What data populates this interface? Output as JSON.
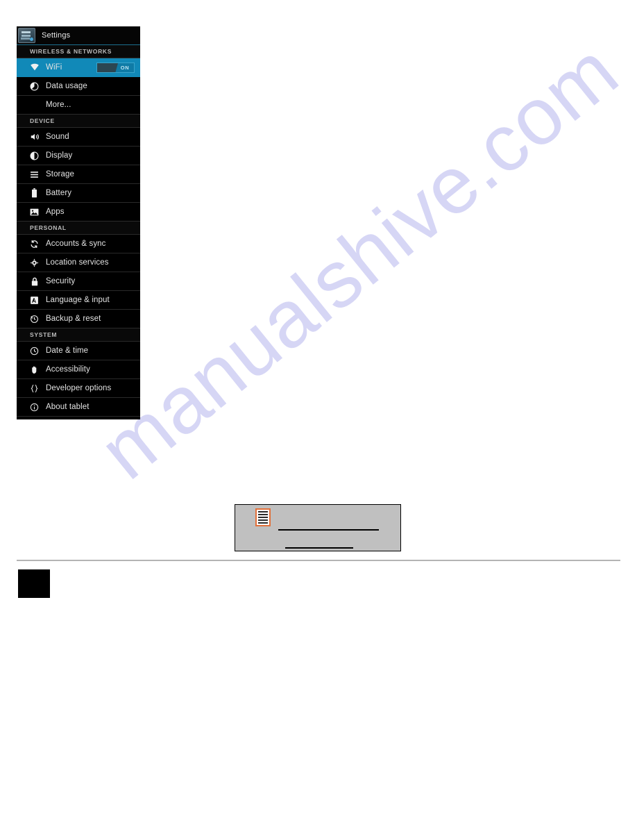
{
  "page": {
    "watermark_text": "manualshive.com",
    "watermark_color": "#d6d6f5",
    "footer_rule_color": "#b4b4b4"
  },
  "settings_panel": {
    "app_icon_name": "settings-app-icon",
    "title": "Settings",
    "accent_color": "#1189b8",
    "background_color": "#000000",
    "groups": [
      {
        "section": "WIRELESS & NETWORKS",
        "items": [
          {
            "label": "WiFi",
            "icon": "wifi-icon",
            "selected": true,
            "toggle": {
              "state_label": "ON",
              "on": true
            }
          },
          {
            "label": "Data usage",
            "icon": "data-usage-icon",
            "selected": false
          },
          {
            "label": "More...",
            "icon": "",
            "selected": false
          }
        ]
      },
      {
        "section": "DEVICE",
        "items": [
          {
            "label": "Sound",
            "icon": "speaker-icon",
            "selected": false
          },
          {
            "label": "Display",
            "icon": "brightness-icon",
            "selected": false
          },
          {
            "label": "Storage",
            "icon": "storage-icon",
            "selected": false
          },
          {
            "label": "Battery",
            "icon": "battery-icon",
            "selected": false
          },
          {
            "label": "Apps",
            "icon": "apps-image-icon",
            "selected": false
          }
        ]
      },
      {
        "section": "PERSONAL",
        "items": [
          {
            "label": "Accounts & sync",
            "icon": "sync-icon",
            "selected": false
          },
          {
            "label": "Location services",
            "icon": "location-icon",
            "selected": false
          },
          {
            "label": "Security",
            "icon": "lock-icon",
            "selected": false
          },
          {
            "label": "Language & input",
            "icon": "language-icon",
            "selected": false
          },
          {
            "label": "Backup & reset",
            "icon": "backup-reset-icon",
            "selected": false
          }
        ]
      },
      {
        "section": "SYSTEM",
        "items": [
          {
            "label": "Date & time",
            "icon": "clock-icon",
            "selected": false
          },
          {
            "label": "Accessibility",
            "icon": "hand-icon",
            "selected": false
          },
          {
            "label": "Developer options",
            "icon": "braces-icon",
            "selected": false
          },
          {
            "label": "About tablet",
            "icon": "info-icon",
            "selected": false
          }
        ]
      }
    ]
  },
  "note_box": {
    "icon_name": "note-list-icon",
    "icon_border_color": "#e2703a",
    "background_color": "#c0c0c0",
    "redacted_lines": 2
  }
}
